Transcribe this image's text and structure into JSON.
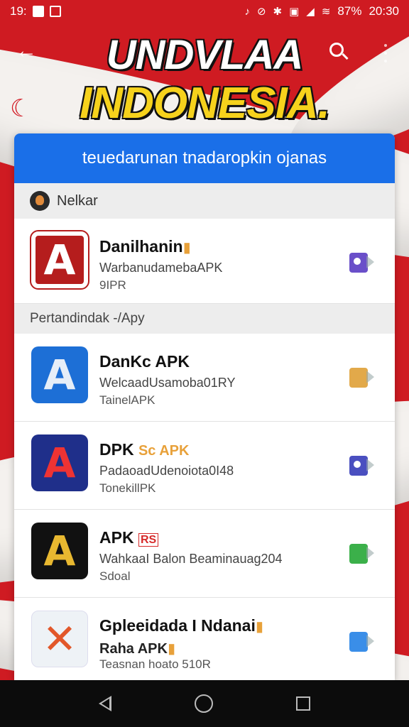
{
  "status_bar": {
    "time_left": "19:",
    "battery": "87%",
    "time_right": "20:30"
  },
  "header": {
    "title_line1": "UNDVLAA",
    "title_line2": "INDONESIA."
  },
  "banner": {
    "text": "teuedarunan tnadaropkin ojanas"
  },
  "section1": {
    "label": "Nelkar"
  },
  "section2": {
    "label": "Pertandindak -/Apy"
  },
  "apps": [
    {
      "name": "Danilhanin",
      "line1": "WarbanudamebaAPK",
      "line2": "9IPR",
      "icon_letter": "A",
      "action_color": "#6a4fc9"
    },
    {
      "name": "DanKc APK",
      "line1": "WelcaadUsamoba01RY",
      "line2": "TainelAPK",
      "icon_letter": "A",
      "action_color": "#e2a94a"
    },
    {
      "name": "DPK",
      "name_tag": "Sc APK",
      "line1": "PadaoadUdenoiota0I48",
      "line2": "TonekillPK",
      "icon_letter": "A",
      "action_color": "#4a4fc0"
    },
    {
      "name": "APK",
      "name_tag": "RS",
      "line1": "WahkaaI Balon Beaminauag204",
      "line2": "Sdoal",
      "icon_letter": "A",
      "action_color": "#3bb04a"
    },
    {
      "name": "Gpleeidada I Ndanai",
      "line1": "Raha APK",
      "line2": "Teasnan hoato 510R",
      "icon_letter": "✕",
      "action_color": "#3a8ee8"
    }
  ],
  "icons": {
    "back": "arrow-left",
    "search": "search",
    "menu": "more-vertical",
    "nav": [
      "nav-back",
      "nav-home",
      "nav-recents"
    ]
  }
}
